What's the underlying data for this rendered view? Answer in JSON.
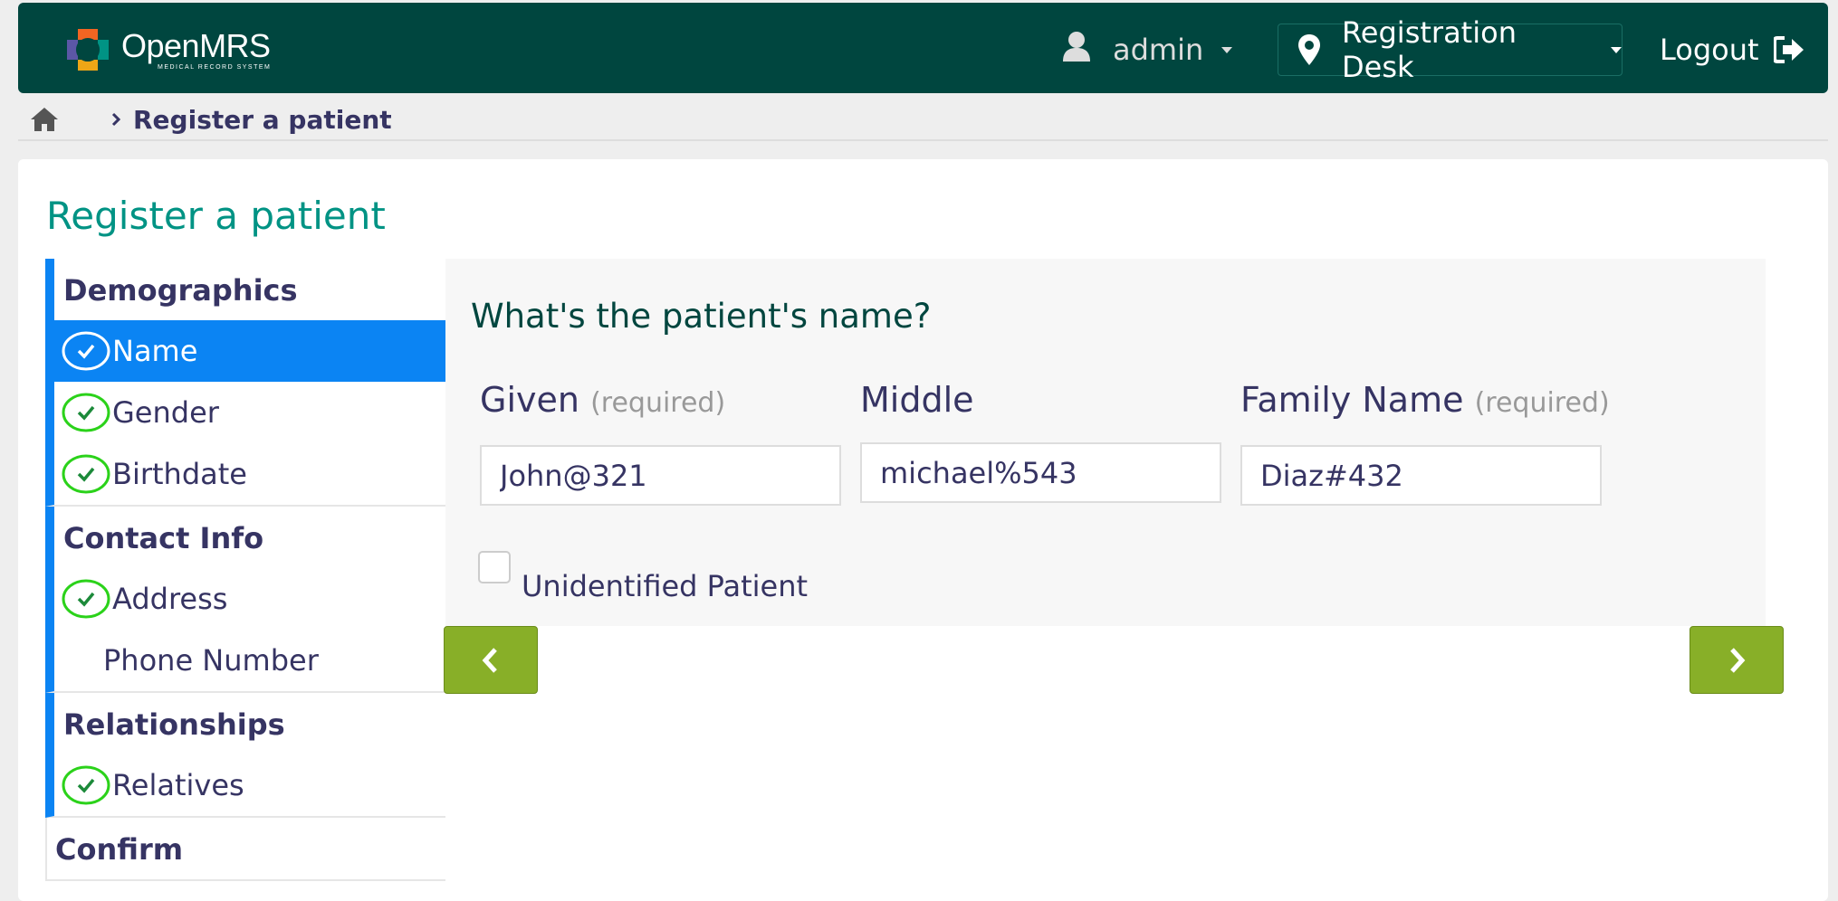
{
  "header": {
    "logo_name": "OpenMRS",
    "logo_sub": "MEDICAL RECORD SYSTEM",
    "user_label": "admin",
    "location_label": "Registration Desk",
    "logout_label": "Logout"
  },
  "breadcrumb": {
    "home_icon": "home-icon",
    "current": "Register a patient"
  },
  "page": {
    "title": "Register a patient"
  },
  "sidebar": {
    "sections": [
      {
        "title": "Demographics",
        "items": [
          {
            "label": "Name",
            "state": "active-complete"
          },
          {
            "label": "Gender",
            "state": "complete"
          },
          {
            "label": "Birthdate",
            "state": "complete"
          }
        ]
      },
      {
        "title": "Contact Info",
        "items": [
          {
            "label": "Address",
            "state": "complete"
          },
          {
            "label": "Phone Number",
            "state": "incomplete"
          }
        ]
      },
      {
        "title": "Relationships",
        "items": [
          {
            "label": "Relatives",
            "state": "complete"
          }
        ]
      },
      {
        "title": "Confirm",
        "items": []
      }
    ]
  },
  "form": {
    "question": "What's the patient's name?",
    "given_label": "Given",
    "given_required": "(required)",
    "given_value": "John@321",
    "middle_label": "Middle",
    "middle_value": "michael%543",
    "family_label": "Family Name",
    "family_required": "(required)",
    "family_value": "Diaz#432",
    "unidentified_label": "Unidentified Patient",
    "unidentified_checked": false
  },
  "colors": {
    "header_bg": "#00463f",
    "accent_teal": "#009384",
    "active_blue": "#0b84f3",
    "check_green": "#2bd21a",
    "nav_button_green": "#88af28"
  }
}
